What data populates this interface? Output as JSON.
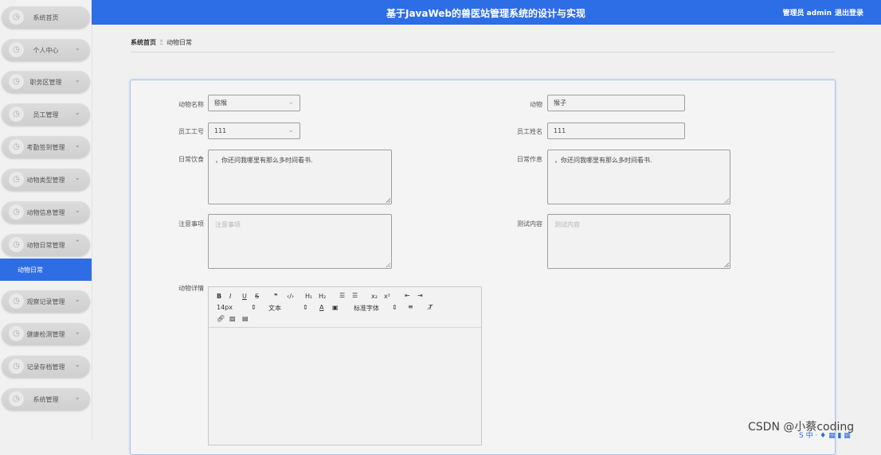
{
  "header": {
    "title": "基于JavaWeb的兽医站管理系统的设计与实现",
    "user": "管理员 admin",
    "logout": "退出登录"
  },
  "sidebar": {
    "items": [
      {
        "label": "系统首页",
        "chevron": false
      },
      {
        "label": "个人中心",
        "chevron": true
      },
      {
        "label": "职务区管理",
        "chevron": true
      },
      {
        "label": "员工管理",
        "chevron": true
      },
      {
        "label": "考勤签到管理",
        "chevron": true
      },
      {
        "label": "动物类型管理",
        "chevron": true
      },
      {
        "label": "动物信息管理",
        "chevron": true
      },
      {
        "label": "动物日常管理",
        "chevron": true,
        "expanded": true
      }
    ],
    "active_sub": "动物日常",
    "items_after": [
      {
        "label": "观察记录管理",
        "chevron": true
      },
      {
        "label": "健康检测管理",
        "chevron": true
      },
      {
        "label": "记录存档管理",
        "chevron": true
      },
      {
        "label": "系统管理",
        "chevron": true
      }
    ]
  },
  "breadcrumb": {
    "home": "系统首页",
    "separator": "Ξ",
    "current": "动物日常"
  },
  "form": {
    "animal_name_label": "动物名称",
    "animal_name_value": "猕猴",
    "animal_label": "动物",
    "animal_value": "猴子",
    "staff_no_label": "员工工号",
    "staff_no_value": "111",
    "staff_name_label": "员工姓名",
    "staff_name_value": "111",
    "diet_label": "日常饮食",
    "diet_value": "，你还问我哪里有那么多时间看书.",
    "routine_label": "日常作息",
    "routine_value": "，你还问我哪里有那么多时间看书.",
    "notes_label": "注意事项",
    "notes_placeholder": "注意事项",
    "test_label": "测试内容",
    "test_placeholder": "测试内容",
    "detail_label": "动物详情"
  },
  "editor": {
    "font_size": "14px",
    "text_type": "文本",
    "font_family": "标准字体",
    "icons": [
      "bold-icon",
      "italic-icon",
      "underline-icon",
      "strikethrough-icon",
      "quote-icon",
      "code-icon",
      "h1-icon",
      "h2-icon",
      "ordered-list-icon",
      "bullet-list-icon",
      "subscript-icon",
      "superscript-icon",
      "indent-icon",
      "outdent-icon",
      "color-icon",
      "background-icon",
      "align-icon",
      "clear-format-icon",
      "link-icon",
      "image-icon",
      "video-icon"
    ]
  },
  "watermark": "CSDN @小蔡coding",
  "colors": {
    "accent": "#2d6de5",
    "sidebar_bg": "#f1f1f1"
  }
}
